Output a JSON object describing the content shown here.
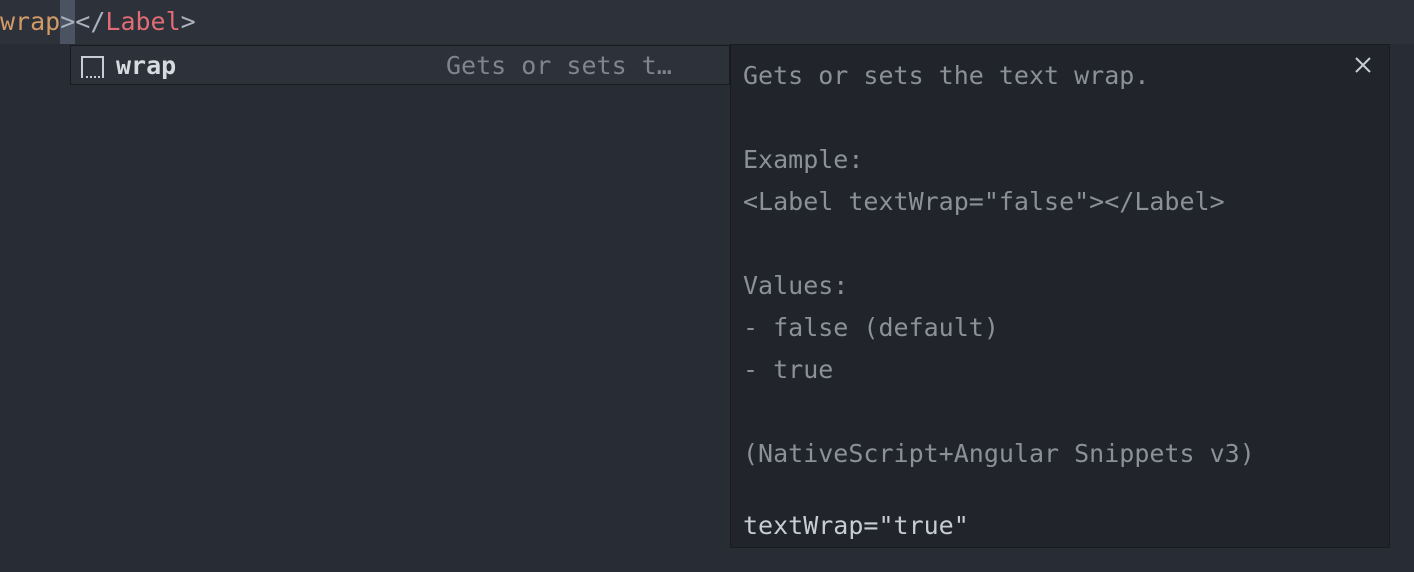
{
  "editor": {
    "attr_text": "wrap",
    "cursor_char": ">",
    "close_open": "</",
    "tag_name": "Label",
    "close_end": ">"
  },
  "suggestion": {
    "icon": "snippet-icon",
    "label": "wrap",
    "detail": "Gets or sets t…"
  },
  "details": {
    "lines": [
      "Gets or sets the text wrap.",
      "",
      "Example:",
      "<Label textWrap=\"false\"></Label>",
      "",
      "Values:",
      "- false (default)",
      "- true",
      "",
      "(NativeScript+Angular Snippets v3)"
    ],
    "insert_text": "textWrap=\"true\"",
    "close_icon": "close-icon"
  },
  "colors": {
    "background": "#282c34",
    "panel": "#21252b",
    "attribute": "#d19a66",
    "tag": "#e06c75"
  }
}
